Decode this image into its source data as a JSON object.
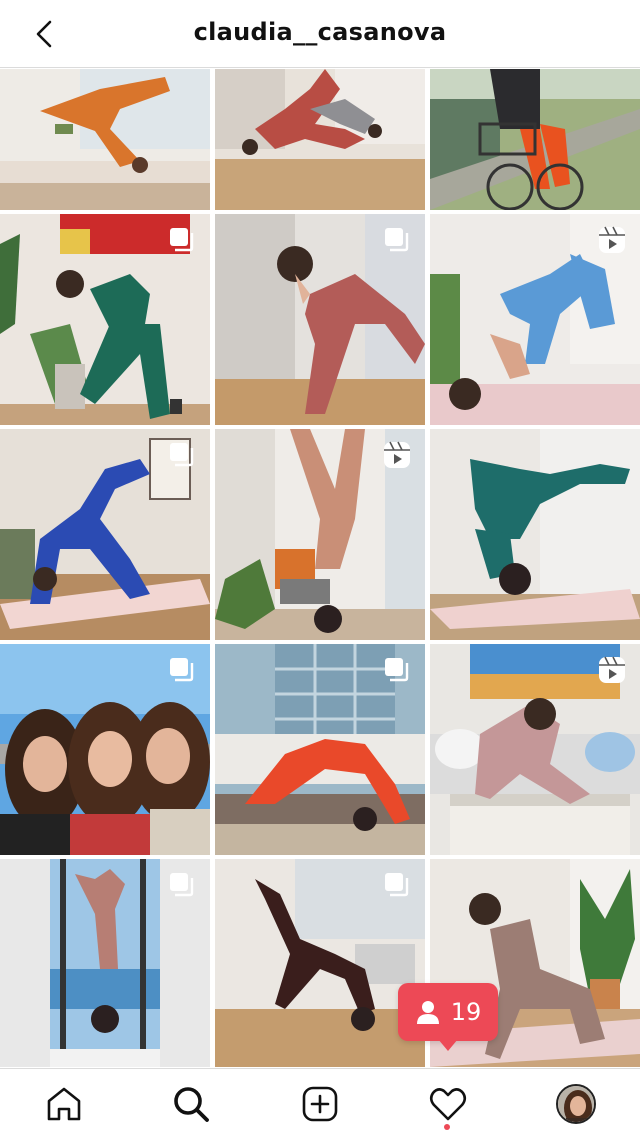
{
  "header": {
    "title": "claudia__casanova",
    "back_icon": "chevron-left-icon"
  },
  "grid": {
    "columns": 3,
    "rows": 5,
    "posts": [
      {
        "badge": "none"
      },
      {
        "badge": "none"
      },
      {
        "badge": "none"
      },
      {
        "badge": "carousel"
      },
      {
        "badge": "carousel"
      },
      {
        "badge": "reel"
      },
      {
        "badge": "carousel"
      },
      {
        "badge": "reel"
      },
      {
        "badge": "none"
      },
      {
        "badge": "carousel"
      },
      {
        "badge": "carousel"
      },
      {
        "badge": "reel"
      },
      {
        "badge": "carousel"
      },
      {
        "badge": "carousel"
      },
      {
        "badge": "none"
      }
    ]
  },
  "notification": {
    "icon": "person-icon",
    "count": "19",
    "color": "#ed4956"
  },
  "tabbar": {
    "items": [
      {
        "name": "home",
        "icon": "home-icon"
      },
      {
        "name": "search",
        "icon": "search-icon",
        "active": true
      },
      {
        "name": "new-post",
        "icon": "plus-square-icon"
      },
      {
        "name": "activity",
        "icon": "heart-icon"
      },
      {
        "name": "profile",
        "icon": "avatar"
      }
    ]
  }
}
